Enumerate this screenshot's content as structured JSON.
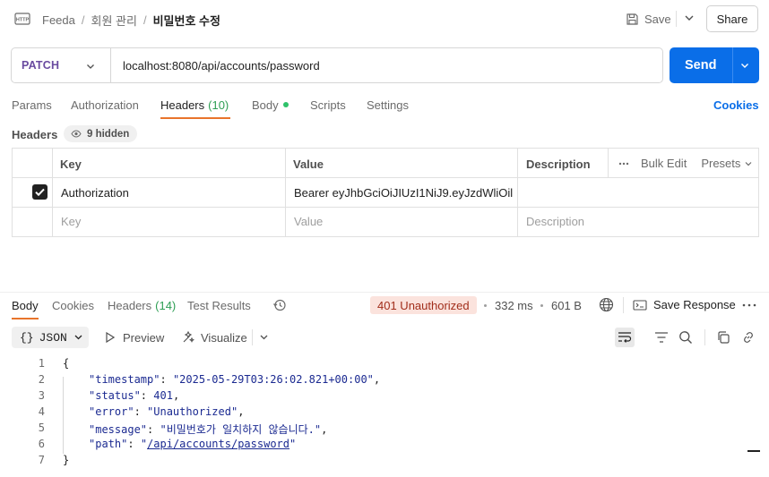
{
  "header": {
    "icon": "http-icon",
    "breadcrumb": [
      "Feeda",
      "회원 관리",
      "비밀번호 수정"
    ],
    "separator": "/",
    "save_label": "Save",
    "share_label": "Share"
  },
  "request": {
    "method": "PATCH",
    "url": "localhost:8080/api/accounts/password",
    "send_label": "Send"
  },
  "request_tabs": [
    {
      "label": "Params"
    },
    {
      "label": "Authorization"
    },
    {
      "label": "Headers",
      "count": "(10)"
    },
    {
      "label": "Body"
    },
    {
      "label": "Scripts"
    },
    {
      "label": "Settings"
    }
  ],
  "cookies_label": "Cookies",
  "headers_section": {
    "title": "Headers",
    "hidden_label": "9 hidden",
    "columns": [
      "Key",
      "Value",
      "Description"
    ],
    "bulk_edit_label": "Bulk Edit",
    "presets_label": "Presets",
    "rows": [
      {
        "checked": true,
        "key": "Authorization",
        "value": "Bearer eyJhbGciOiJIUzI1NiJ9.eyJzdWliOil...",
        "description": ""
      }
    ],
    "placeholder": {
      "key": "Key",
      "value": "Value",
      "description": "Description"
    }
  },
  "response": {
    "tabs": [
      {
        "label": "Body"
      },
      {
        "label": "Cookies"
      },
      {
        "label": "Headers",
        "count": "(14)"
      },
      {
        "label": "Test Results"
      }
    ],
    "status": "401 Unauthorized",
    "time": "332 ms",
    "size": "601 B",
    "save_response_label": "Save Response",
    "format_label": "JSON",
    "preview_label": "Preview",
    "visualize_label": "Visualize",
    "status_color": "#a12d1a"
  },
  "code_lines": [
    {
      "n": "1"
    },
    {
      "n": "2",
      "key": "\"timestamp\"",
      "value": "\"2025-05-29T03:26:02.821+00:00\""
    },
    {
      "n": "3",
      "key": "\"status\"",
      "value": "401"
    },
    {
      "n": "4",
      "key": "\"error\"",
      "value": "\"Unauthorized\""
    },
    {
      "n": "5",
      "key": "\"message\"",
      "value": "\"비밀번호가 일치하지 않습니다.\""
    },
    {
      "n": "6",
      "key": "\"path\"",
      "value_open": "\"",
      "value_link": "/api/accounts/password",
      "value_close": "\""
    },
    {
      "n": "7"
    }
  ],
  "code_punct": {
    "open": "{",
    "close": "}",
    "colon": ": ",
    "comma": ","
  },
  "colors": {
    "accent": "#0a6ee8",
    "active_tab": "#e8742b",
    "method": "#6a4ba0",
    "count": "#2e9e54"
  }
}
